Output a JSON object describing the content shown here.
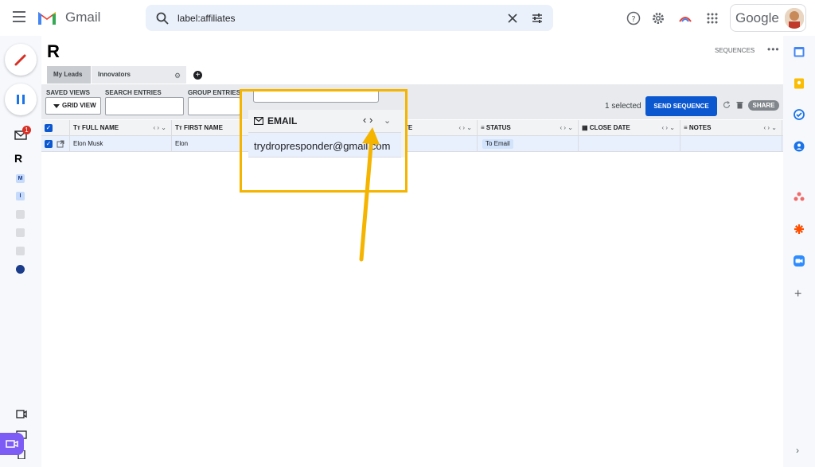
{
  "app": {
    "brand": "Gmail",
    "google_word": "Google"
  },
  "search": {
    "query": "label:affiliates"
  },
  "left_rail": {
    "mail_badge": "1",
    "squares": [
      "M",
      "I",
      "",
      "",
      "",
      ""
    ]
  },
  "panel": {
    "sequences_link": "SEQUENCES",
    "tabs": [
      {
        "label": "My Leads"
      },
      {
        "label": "Innovators"
      }
    ],
    "toolbar": {
      "saved_views_label": "SAVED VIEWS",
      "search_entries_label": "SEARCH ENTRIES",
      "group_entries_label": "GROUP ENTRIES",
      "grid_view_label": "GRID VIEW",
      "selected_text": "1 selected",
      "send_sequence_label": "SEND SEQUENCE",
      "share_label": "SHARE"
    },
    "columns": {
      "full_name": "FULL NAME",
      "first_name": "FIRST NAME",
      "date_partial": "TE",
      "status": "STATUS",
      "close_date": "CLOSE DATE",
      "notes": "NOTES",
      "col_ctrl": "‹ › ⌄",
      "tt": "Tт"
    },
    "rows": [
      {
        "full_name": "Elon Musk",
        "first_name": "Elon",
        "status": "To Email"
      }
    ]
  },
  "callout": {
    "column_title": "EMAIL",
    "email_value": "trydropresponder@gmail.com",
    "ctrl": "‹ ›",
    "chevron": "⌄"
  },
  "colors": {
    "accent": "#0b57d0",
    "highlight": "#f4b400",
    "badge": "#d93025"
  }
}
